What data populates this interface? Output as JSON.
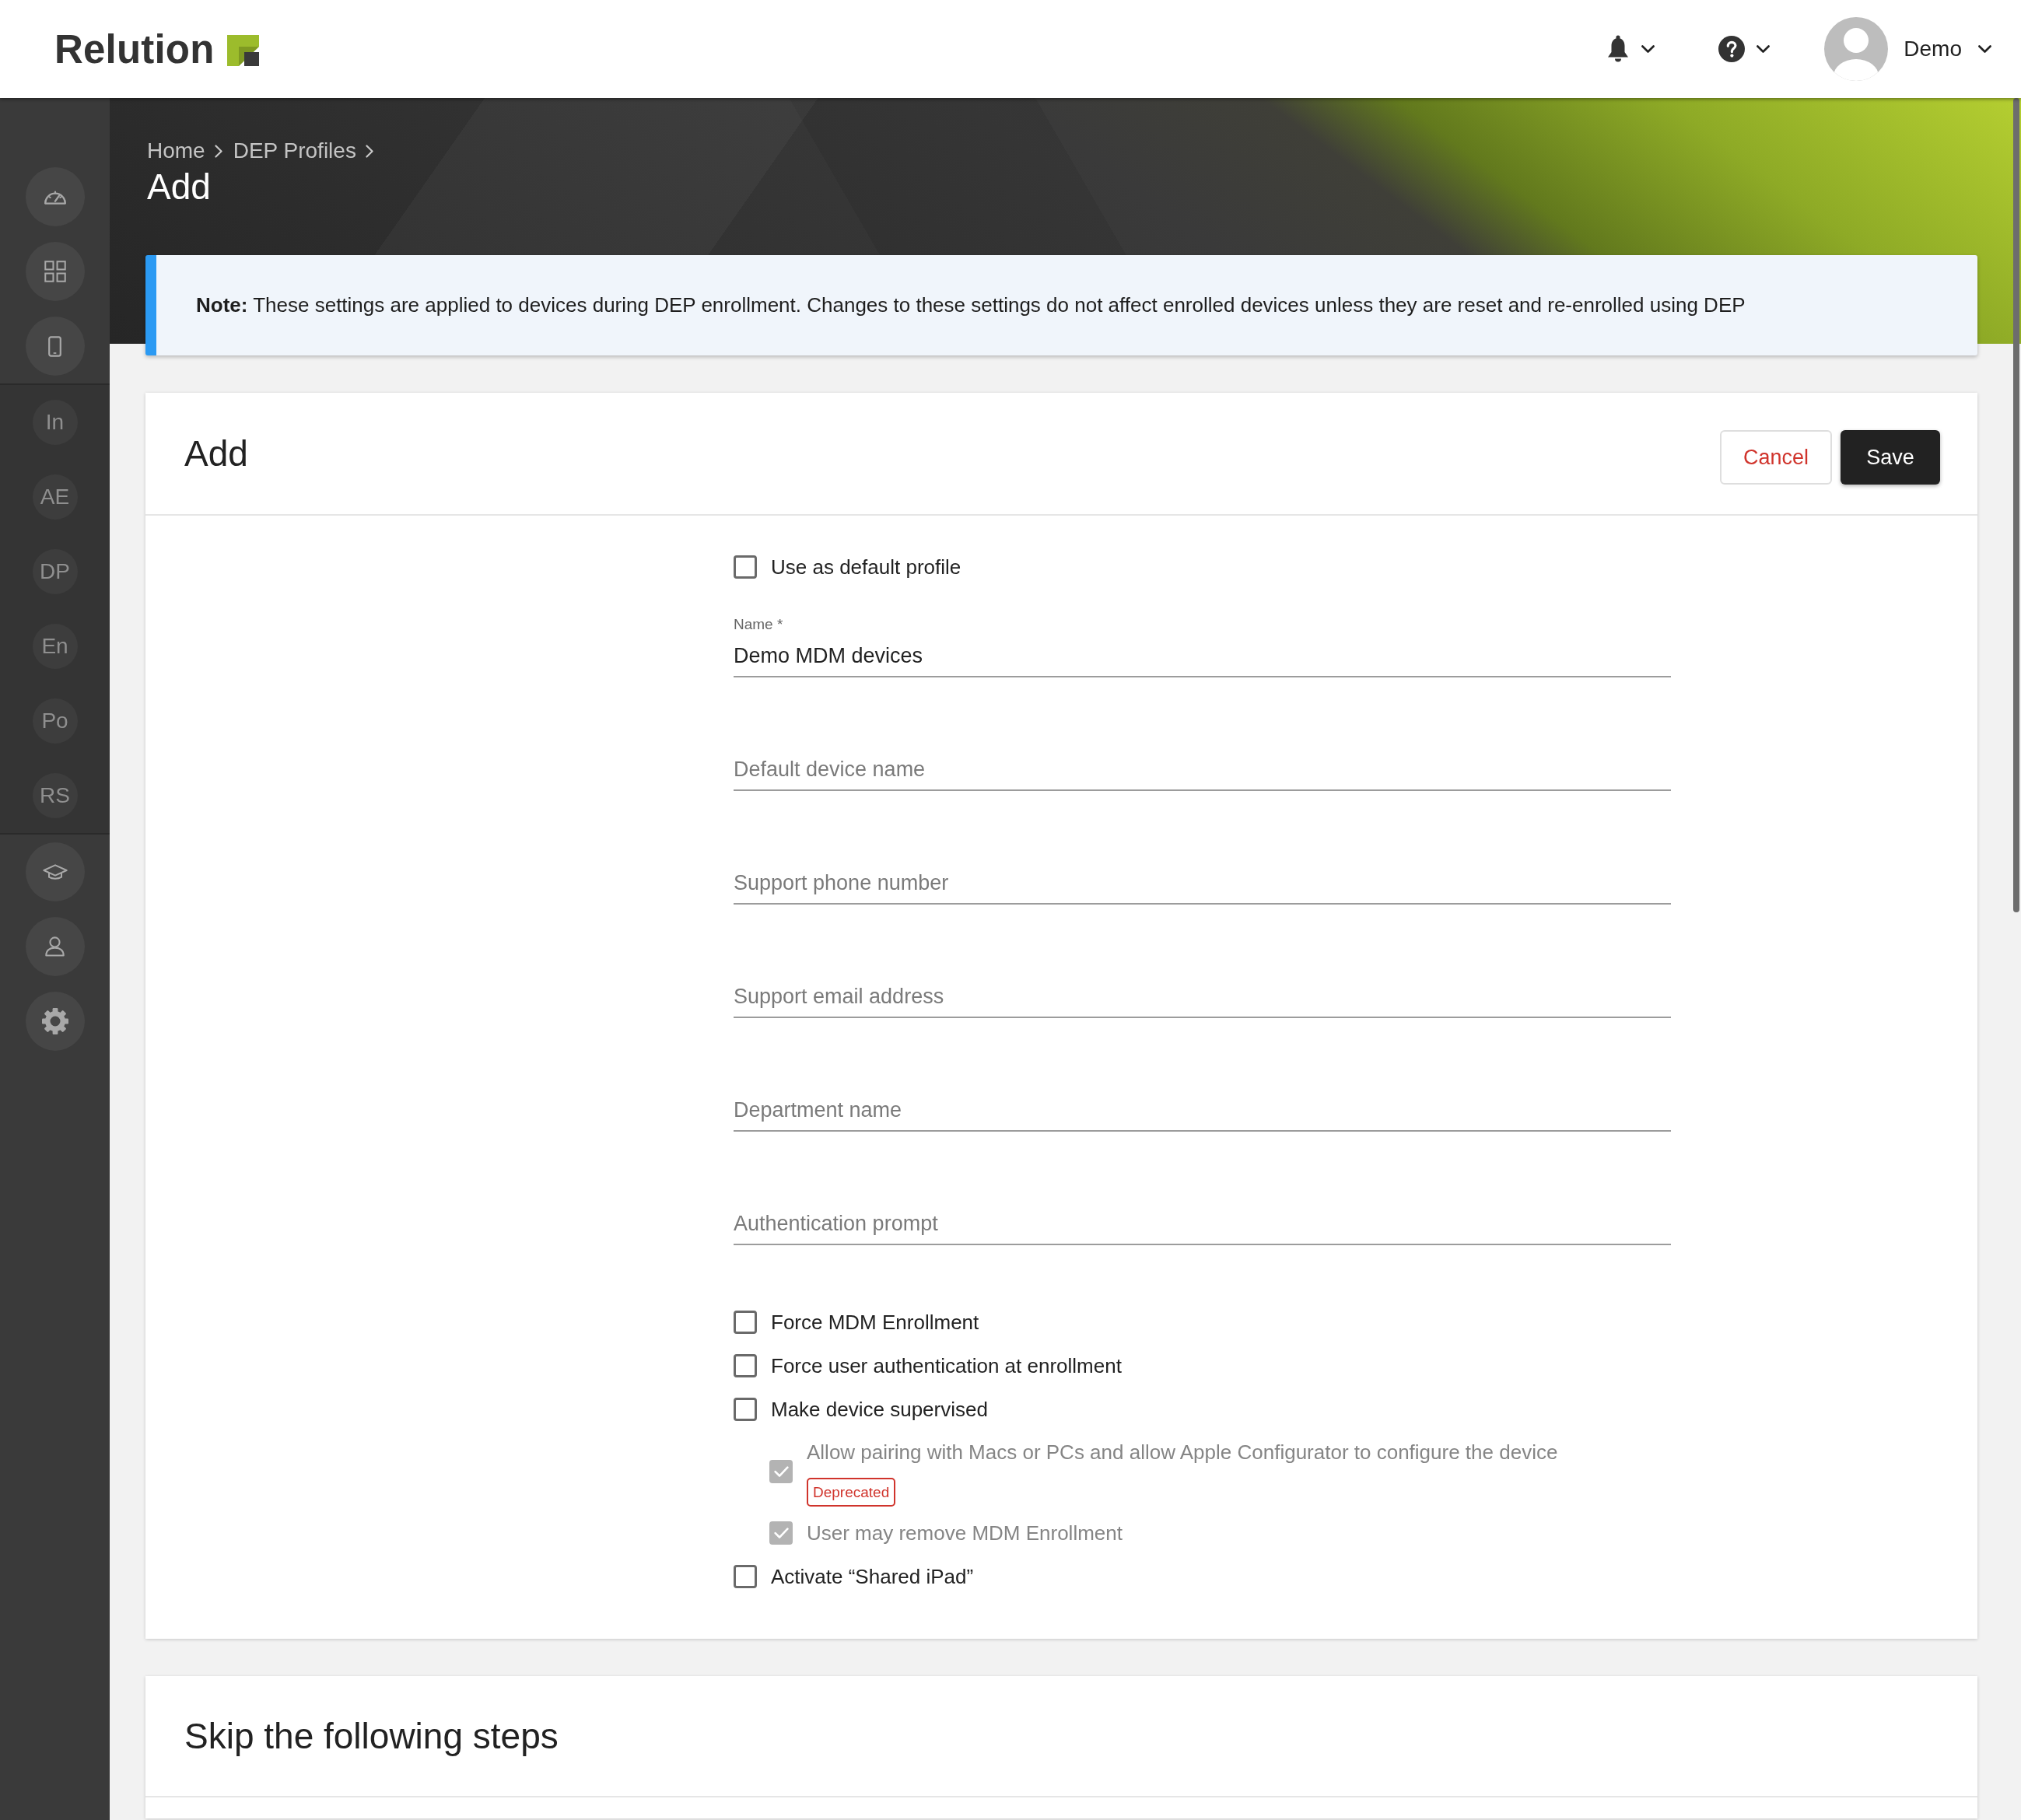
{
  "header": {
    "logo": "Relution",
    "user_name": "Demo"
  },
  "sidebar": {
    "items": [
      {
        "label": "In"
      },
      {
        "label": "AE"
      },
      {
        "label": "DP"
      },
      {
        "label": "En"
      },
      {
        "label": "Po"
      },
      {
        "label": "RS"
      }
    ]
  },
  "page_header": {
    "breadcrumb": [
      "Home",
      "DEP Profiles"
    ],
    "title": "Add"
  },
  "note": "**Note:** These settings are applied to devices during DEP enrollment. Changes to these settings do not affect enrolled devices unless they are reset and re-enrolled using DEP",
  "form_card": {
    "title": "Add",
    "buttons": [
      {
        "label": "Cancel",
        "kind": "secondary"
      },
      {
        "label": "Save",
        "kind": "primary"
      }
    ],
    "default_profile": {
      "label": "Use as default profile",
      "checked": false
    },
    "fields": [
      {
        "label": "Name *",
        "value": "Demo MDM devices"
      },
      {
        "placeholder": "Default device name"
      },
      {
        "placeholder": "Support phone number"
      },
      {
        "placeholder": "Support email address"
      },
      {
        "placeholder": "Department name"
      },
      {
        "placeholder": "Authentication prompt"
      }
    ],
    "options": [
      {
        "label": "Force MDM Enrollment",
        "checked": false,
        "disabled": false
      },
      {
        "label": "Force user authentication at enrollment",
        "checked": false,
        "disabled": false
      },
      {
        "label": "Make device supervised",
        "checked": false,
        "disabled": false,
        "children": [
          {
            "label": "Allow pairing with Macs or PCs and allow Apple Configurator to configure the device",
            "checked": true,
            "disabled": true,
            "badge": "Deprecated"
          },
          {
            "label": "User may remove MDM Enrollment",
            "checked": true,
            "disabled": true
          }
        ]
      },
      {
        "label": "Activate “Shared iPad”",
        "checked": false,
        "disabled": false
      }
    ]
  },
  "skip_card": {
    "title": "Skip the following steps"
  }
}
